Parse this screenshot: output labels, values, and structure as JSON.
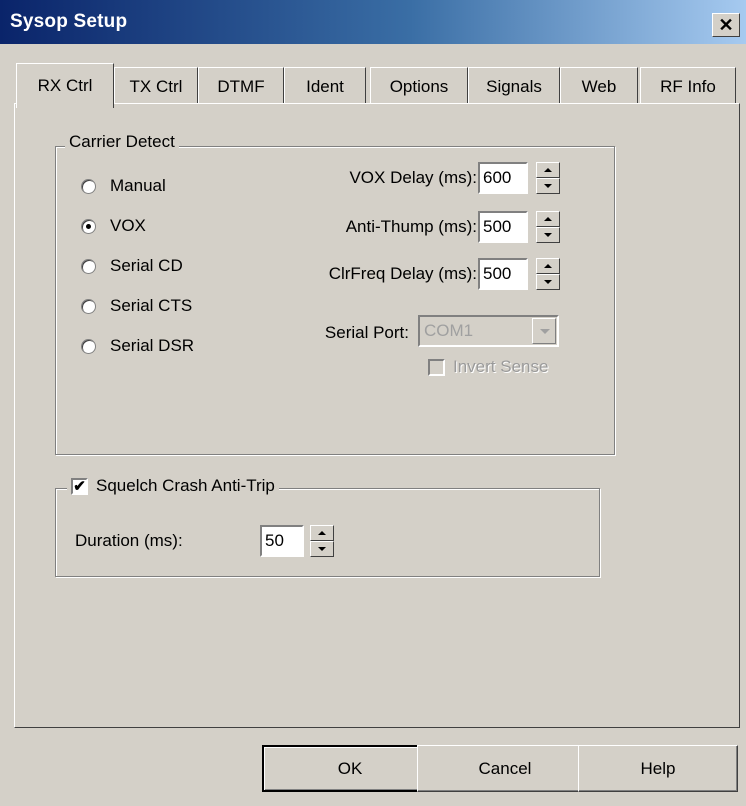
{
  "window": {
    "title": "Sysop Setup",
    "close_glyph": "✕"
  },
  "tabs": [
    {
      "label": "RX Ctrl",
      "active": true
    },
    {
      "label": "TX Ctrl"
    },
    {
      "label": "DTMF"
    },
    {
      "label": "Ident"
    },
    {
      "label": "Options"
    },
    {
      "label": "Signals"
    },
    {
      "label": "Web"
    },
    {
      "label": "RF Info"
    }
  ],
  "carrier_detect": {
    "legend": "Carrier Detect",
    "options": [
      {
        "label": "Manual",
        "selected": false
      },
      {
        "label": "VOX",
        "selected": true
      },
      {
        "label": "Serial CD",
        "selected": false
      },
      {
        "label": "Serial CTS",
        "selected": false
      },
      {
        "label": "Serial DSR",
        "selected": false
      }
    ],
    "vox_delay": {
      "label": "VOX Delay (ms):",
      "value": "600"
    },
    "anti_thump": {
      "label": "Anti-Thump (ms):",
      "value": "500"
    },
    "clrfreq_delay": {
      "label": "ClrFreq Delay (ms):",
      "value": "500"
    },
    "serial_port": {
      "label": "Serial Port:",
      "value": "COM1"
    },
    "invert_sense": {
      "label": "Invert Sense",
      "checked": false,
      "enabled": false
    }
  },
  "squelch": {
    "legend": "Squelch Crash Anti-Trip",
    "checked": true,
    "check_glyph": "✔",
    "duration": {
      "label": "Duration (ms):",
      "value": "50"
    }
  },
  "buttons": {
    "ok": "OK",
    "cancel": "Cancel",
    "help": "Help"
  },
  "colors": {
    "face": "#d4d0c8",
    "title_start": "#0a246a",
    "title_end": "#a6caf0"
  }
}
